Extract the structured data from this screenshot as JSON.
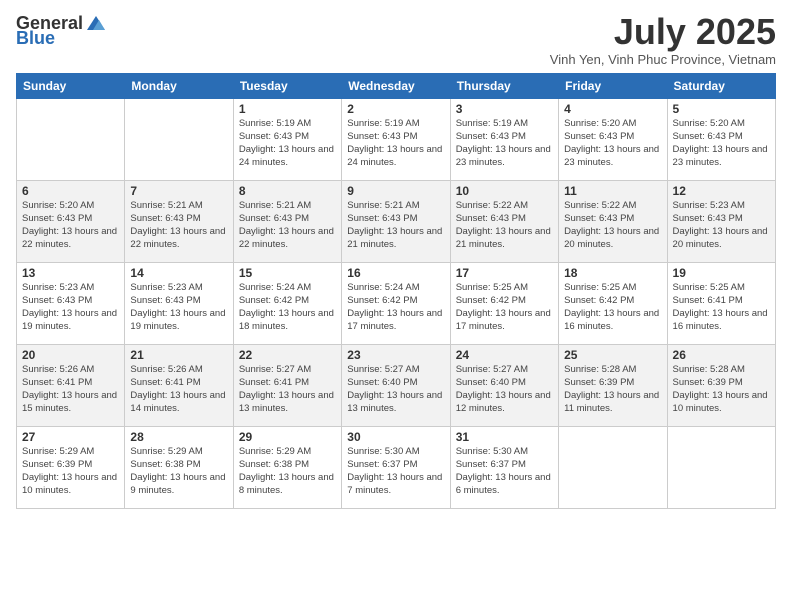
{
  "logo": {
    "general": "General",
    "blue": "Blue"
  },
  "title": "July 2025",
  "location": "Vinh Yen, Vinh Phuc Province, Vietnam",
  "headers": [
    "Sunday",
    "Monday",
    "Tuesday",
    "Wednesday",
    "Thursday",
    "Friday",
    "Saturday"
  ],
  "weeks": [
    [
      {
        "num": "",
        "info": ""
      },
      {
        "num": "",
        "info": ""
      },
      {
        "num": "1",
        "info": "Sunrise: 5:19 AM\nSunset: 6:43 PM\nDaylight: 13 hours and 24 minutes."
      },
      {
        "num": "2",
        "info": "Sunrise: 5:19 AM\nSunset: 6:43 PM\nDaylight: 13 hours and 24 minutes."
      },
      {
        "num": "3",
        "info": "Sunrise: 5:19 AM\nSunset: 6:43 PM\nDaylight: 13 hours and 23 minutes."
      },
      {
        "num": "4",
        "info": "Sunrise: 5:20 AM\nSunset: 6:43 PM\nDaylight: 13 hours and 23 minutes."
      },
      {
        "num": "5",
        "info": "Sunrise: 5:20 AM\nSunset: 6:43 PM\nDaylight: 13 hours and 23 minutes."
      }
    ],
    [
      {
        "num": "6",
        "info": "Sunrise: 5:20 AM\nSunset: 6:43 PM\nDaylight: 13 hours and 22 minutes."
      },
      {
        "num": "7",
        "info": "Sunrise: 5:21 AM\nSunset: 6:43 PM\nDaylight: 13 hours and 22 minutes."
      },
      {
        "num": "8",
        "info": "Sunrise: 5:21 AM\nSunset: 6:43 PM\nDaylight: 13 hours and 22 minutes."
      },
      {
        "num": "9",
        "info": "Sunrise: 5:21 AM\nSunset: 6:43 PM\nDaylight: 13 hours and 21 minutes."
      },
      {
        "num": "10",
        "info": "Sunrise: 5:22 AM\nSunset: 6:43 PM\nDaylight: 13 hours and 21 minutes."
      },
      {
        "num": "11",
        "info": "Sunrise: 5:22 AM\nSunset: 6:43 PM\nDaylight: 13 hours and 20 minutes."
      },
      {
        "num": "12",
        "info": "Sunrise: 5:23 AM\nSunset: 6:43 PM\nDaylight: 13 hours and 20 minutes."
      }
    ],
    [
      {
        "num": "13",
        "info": "Sunrise: 5:23 AM\nSunset: 6:43 PM\nDaylight: 13 hours and 19 minutes."
      },
      {
        "num": "14",
        "info": "Sunrise: 5:23 AM\nSunset: 6:43 PM\nDaylight: 13 hours and 19 minutes."
      },
      {
        "num": "15",
        "info": "Sunrise: 5:24 AM\nSunset: 6:42 PM\nDaylight: 13 hours and 18 minutes."
      },
      {
        "num": "16",
        "info": "Sunrise: 5:24 AM\nSunset: 6:42 PM\nDaylight: 13 hours and 17 minutes."
      },
      {
        "num": "17",
        "info": "Sunrise: 5:25 AM\nSunset: 6:42 PM\nDaylight: 13 hours and 17 minutes."
      },
      {
        "num": "18",
        "info": "Sunrise: 5:25 AM\nSunset: 6:42 PM\nDaylight: 13 hours and 16 minutes."
      },
      {
        "num": "19",
        "info": "Sunrise: 5:25 AM\nSunset: 6:41 PM\nDaylight: 13 hours and 16 minutes."
      }
    ],
    [
      {
        "num": "20",
        "info": "Sunrise: 5:26 AM\nSunset: 6:41 PM\nDaylight: 13 hours and 15 minutes."
      },
      {
        "num": "21",
        "info": "Sunrise: 5:26 AM\nSunset: 6:41 PM\nDaylight: 13 hours and 14 minutes."
      },
      {
        "num": "22",
        "info": "Sunrise: 5:27 AM\nSunset: 6:41 PM\nDaylight: 13 hours and 13 minutes."
      },
      {
        "num": "23",
        "info": "Sunrise: 5:27 AM\nSunset: 6:40 PM\nDaylight: 13 hours and 13 minutes."
      },
      {
        "num": "24",
        "info": "Sunrise: 5:27 AM\nSunset: 6:40 PM\nDaylight: 13 hours and 12 minutes."
      },
      {
        "num": "25",
        "info": "Sunrise: 5:28 AM\nSunset: 6:39 PM\nDaylight: 13 hours and 11 minutes."
      },
      {
        "num": "26",
        "info": "Sunrise: 5:28 AM\nSunset: 6:39 PM\nDaylight: 13 hours and 10 minutes."
      }
    ],
    [
      {
        "num": "27",
        "info": "Sunrise: 5:29 AM\nSunset: 6:39 PM\nDaylight: 13 hours and 10 minutes."
      },
      {
        "num": "28",
        "info": "Sunrise: 5:29 AM\nSunset: 6:38 PM\nDaylight: 13 hours and 9 minutes."
      },
      {
        "num": "29",
        "info": "Sunrise: 5:29 AM\nSunset: 6:38 PM\nDaylight: 13 hours and 8 minutes."
      },
      {
        "num": "30",
        "info": "Sunrise: 5:30 AM\nSunset: 6:37 PM\nDaylight: 13 hours and 7 minutes."
      },
      {
        "num": "31",
        "info": "Sunrise: 5:30 AM\nSunset: 6:37 PM\nDaylight: 13 hours and 6 minutes."
      },
      {
        "num": "",
        "info": ""
      },
      {
        "num": "",
        "info": ""
      }
    ]
  ]
}
